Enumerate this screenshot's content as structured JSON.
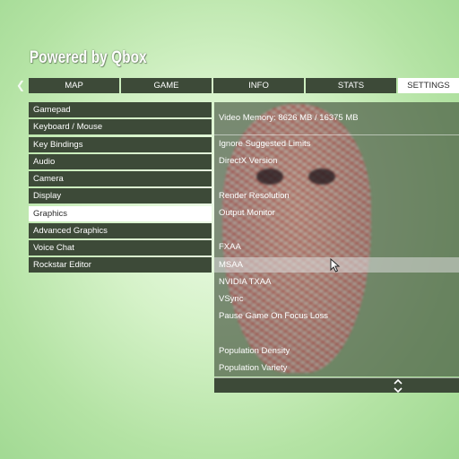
{
  "header": {
    "title": "Powered by Qbox"
  },
  "tabs": [
    {
      "label": "MAP"
    },
    {
      "label": "GAME"
    },
    {
      "label": "INFO"
    },
    {
      "label": "STATS"
    },
    {
      "label": "SETTINGS"
    }
  ],
  "sidebar": {
    "items": [
      {
        "label": "Gamepad"
      },
      {
        "label": "Keyboard / Mouse"
      },
      {
        "label": "Key Bindings"
      },
      {
        "label": "Audio"
      },
      {
        "label": "Camera"
      },
      {
        "label": "Display"
      },
      {
        "label": "Graphics"
      },
      {
        "label": "Advanced Graphics"
      },
      {
        "label": "Voice Chat"
      },
      {
        "label": "Rockstar Editor"
      }
    ],
    "active_index": 6
  },
  "panel": {
    "video_memory": "Video Memory: 8626 MB / 16375 MB",
    "options": [
      {
        "label": "Ignore Suggested Limits"
      },
      {
        "label": "DirectX Version"
      },
      {
        "label": ""
      },
      {
        "label": "Render Resolution"
      },
      {
        "label": "Output Monitor"
      },
      {
        "label": ""
      },
      {
        "label": "FXAA"
      },
      {
        "label": "MSAA"
      },
      {
        "label": "NVIDIA TXAA"
      },
      {
        "label": "VSync"
      },
      {
        "label": "Pause Game On Focus Loss"
      },
      {
        "label": ""
      },
      {
        "label": "Population Density"
      },
      {
        "label": "Population Variety"
      }
    ],
    "highlighted_index": 7
  },
  "colors": {
    "tab_bg": "#3d4a38",
    "active_bg": "#ffffff",
    "accent": "#4aa6e8",
    "background": "#c8eebc"
  },
  "icons": {
    "tab_left": "chevron-left-icon",
    "footer_scroll": "up-down-arrows-icon",
    "pointer": "mouse-cursor-icon"
  }
}
